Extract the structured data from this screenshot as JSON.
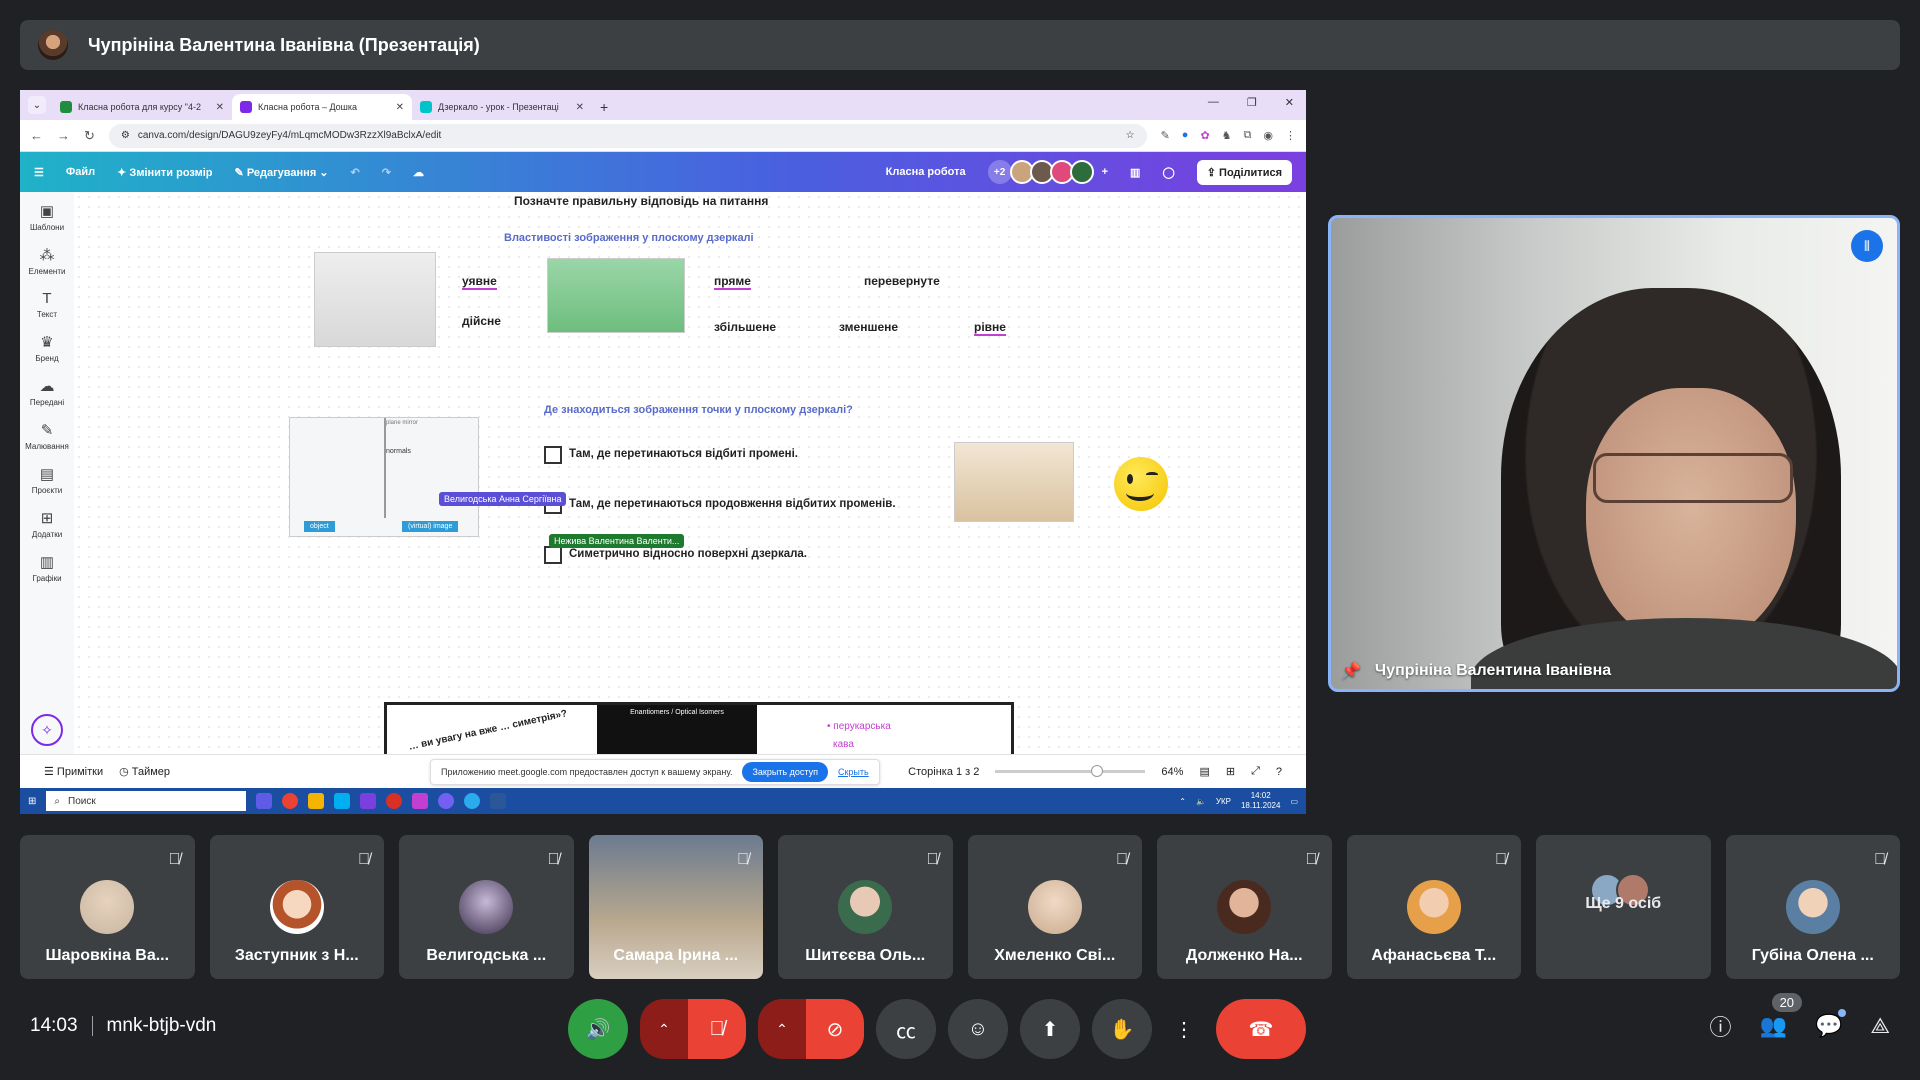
{
  "presenter_bar": {
    "title": "Чупрініна Валентина Іванівна (Презентація)"
  },
  "browser": {
    "tabs": [
      {
        "title": "Класна робота для курсу \"4-2",
        "color": "#1e8e3e"
      },
      {
        "title": "Класна робота – Дошка",
        "color": "#7d2ae8"
      },
      {
        "title": "Дзеркало - урок - Презентаці",
        "color": "#00c4cc"
      }
    ],
    "url": "canva.com/design/DAGU9zeyFy4/mLqmcMODw3RzzXl9aBclxA/edit"
  },
  "canva": {
    "toolbar": {
      "file": "Файл",
      "resize": "Змінити розмір",
      "edit": "Редагування",
      "doc_title": "Класна робота",
      "collab_count": "+2",
      "share": "Поділитися"
    },
    "sidebar": [
      {
        "label": "Шаблони",
        "icon": "▣"
      },
      {
        "label": "Елементи",
        "icon": "⁂"
      },
      {
        "label": "Текст",
        "icon": "T"
      },
      {
        "label": "Бренд",
        "icon": "♛"
      },
      {
        "label": "Передані",
        "icon": "☁"
      },
      {
        "label": "Малювання",
        "icon": "✎"
      },
      {
        "label": "Проєкти",
        "icon": "▤"
      },
      {
        "label": "Додатки",
        "icon": "⊞"
      },
      {
        "label": "Графіки",
        "icon": "▥"
      }
    ],
    "slide": {
      "heading": "Позначте правильну відповідь на питання",
      "subtitle1": "Властивості зображення у плоскому дзеркалі",
      "words": {
        "uyavne": "уявне",
        "diysne": "дійсне",
        "pryame": "пряме",
        "perevernute": "перевернуте",
        "zbilshene": "збільшене",
        "zmenshene": "зменшене",
        "rivne": "рівне"
      },
      "subtitle2": "Де знаходиться зображення точки у плоскому дзеркалі?",
      "answers": [
        "Там, де перетинаються відбиті промені.",
        "Там, де перетинаються продовження відбитих променів.",
        "Симетрично відносно поверхні дзеркала."
      ],
      "cursor_labels": {
        "velygodska": "Велигодська Анна Сергіївна",
        "nezhyva": "Нежива Валентина Валенти..."
      },
      "diagram_labels": {
        "object": "object",
        "virtual_image": "(virtual) image",
        "normals": "normals",
        "plane_mirror": "plane mirror"
      },
      "next_slide": {
        "inner_title": "Enantiomers / Optical Isomers",
        "rotated_text": "… ви увагу на вже … симетрія»?",
        "list_item": "перукарська",
        "list_item2": "кава"
      }
    },
    "bottom": {
      "notes": "Примітки",
      "timer": "Таймер",
      "page_info": "Сторінка 1 з 2",
      "zoom": "64%"
    },
    "meet_notice": {
      "text": "Приложению meet.google.com предоставлен доступ к вашему экрану.",
      "button": "Закрыть доступ",
      "link": "Скрыть"
    }
  },
  "taskbar": {
    "search_placeholder": "Поиск",
    "lang": "УКР",
    "time": "14:02",
    "date": "18.11.2024"
  },
  "presenter_video": {
    "name": "Чупрініна Валентина Іванівна"
  },
  "participants": [
    {
      "name": "Шаровкіна Ва...",
      "color": "#c9b6a0"
    },
    {
      "name": "Заступник з Н...",
      "color": "#f1f1f1"
    },
    {
      "name": "Велигодська ...",
      "color": "#6d5a7e"
    },
    {
      "name": "Самара Ірина ...",
      "color": "#d9c9a7"
    },
    {
      "name": "Шитєєва Оль...",
      "color": "#3a6b4d"
    },
    {
      "name": "Хмеленко Сві...",
      "color": "#d8c1a9"
    },
    {
      "name": "Долженко На...",
      "color": "#6e4a3a"
    },
    {
      "name": "Афанасьєва Т...",
      "color": "#e7a04a"
    }
  ],
  "more_people": {
    "label": "Ще 9 осіб"
  },
  "last_participant": {
    "name": "Губіна Олена ...",
    "color": "#8aa7c4"
  },
  "meeting": {
    "time": "14:03",
    "code": "mnk-btjb-vdn",
    "people_count": "20"
  }
}
